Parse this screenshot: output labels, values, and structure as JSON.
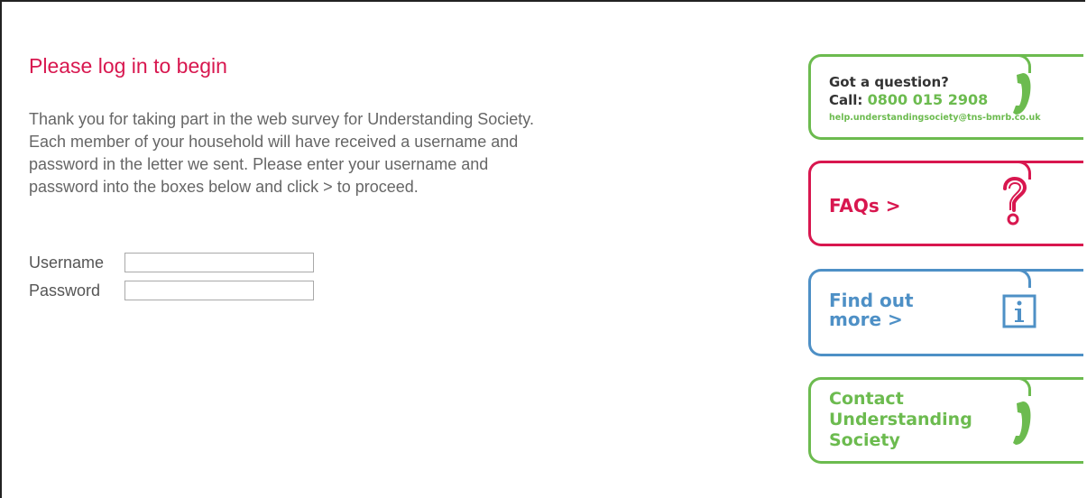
{
  "login": {
    "heading": "Please log in to begin",
    "intro": "Thank you for taking part in the web survey for Understanding Society. Each member of your household will have received a username and password in the letter we sent. Please enter your username and password into the boxes below and click > to proceed.",
    "username_label": "Username",
    "username_value": "",
    "password_label": "Password",
    "password_value": ""
  },
  "sidebar": {
    "question": {
      "title": "Got a question?",
      "call_label": "Call:",
      "phone": "0800 015 2908",
      "email": "help.understandingsociety@tns-bmrb.co.uk",
      "icon": "phone-icon",
      "color": "#6cbb4f"
    },
    "faq": {
      "label": "FAQs >",
      "icon": "question-mark-icon",
      "color": "#d8174f"
    },
    "find_out": {
      "line1": "Find out",
      "line2": "more >",
      "icon": "info-icon",
      "color": "#4e90c6"
    },
    "contact": {
      "line1": "Contact",
      "line2": "Understanding",
      "line3": "Society",
      "icon": "phone-icon",
      "color": "#6cbb4f"
    }
  }
}
